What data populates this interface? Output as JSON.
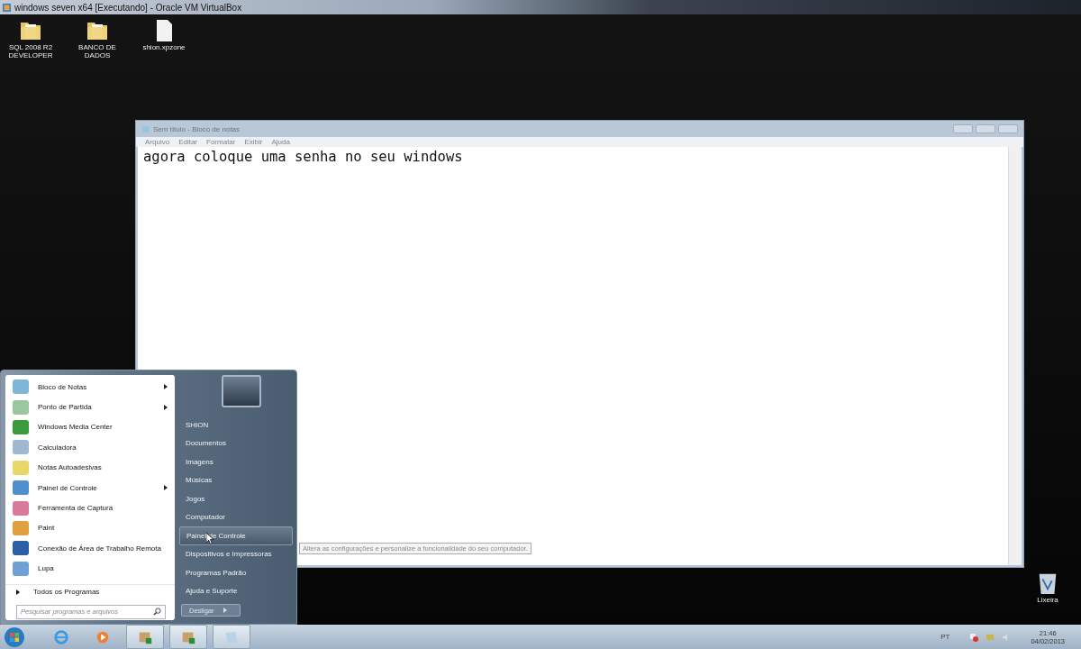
{
  "vm_window": {
    "title": "windows seven x64 [Executando] - Oracle VM VirtualBox"
  },
  "desktop_icons": [
    {
      "label": "SQL 2008 R2 DEVELOPER",
      "kind": "folder"
    },
    {
      "label": "BANCO DE DADOS",
      "kind": "folder"
    },
    {
      "label": "shion.xpzone",
      "kind": "file"
    }
  ],
  "recycle_bin": {
    "label": "Lixeira"
  },
  "notepad": {
    "title": "Sem título - Bloco de notas",
    "menu": [
      "Arquivo",
      "Editar",
      "Formatar",
      "Exibir",
      "Ajuda"
    ],
    "text": "agora coloque uma senha no seu windows"
  },
  "start_menu": {
    "programs": [
      {
        "label": "Bloco de Notas",
        "submenu": true,
        "kind": "notepad"
      },
      {
        "label": "Ponto de Partida",
        "submenu": true,
        "kind": "start"
      },
      {
        "label": "Windows Media Center",
        "submenu": false,
        "kind": "media"
      },
      {
        "label": "Calculadora",
        "submenu": false,
        "kind": "calc"
      },
      {
        "label": "Notas Autoadesivas",
        "submenu": false,
        "kind": "sticky"
      },
      {
        "label": "Painel de Controle",
        "submenu": true,
        "kind": "panel"
      },
      {
        "label": "Ferramenta de Captura",
        "submenu": false,
        "kind": "snip"
      },
      {
        "label": "Paint",
        "submenu": false,
        "kind": "paint"
      },
      {
        "label": "Conexão de Área de Trabalho Remota",
        "submenu": false,
        "kind": "remote"
      },
      {
        "label": "Lupa",
        "submenu": false,
        "kind": "magnifier"
      }
    ],
    "all_programs": "Todos os Programas",
    "search": {
      "placeholder": "Pesquisar programas e arquivos"
    },
    "places": [
      {
        "label": "SHION",
        "selected": false
      },
      {
        "label": "Documentos",
        "selected": false
      },
      {
        "label": "Imagens",
        "selected": false
      },
      {
        "label": "Músicas",
        "selected": false
      },
      {
        "label": "Jogos",
        "selected": false
      },
      {
        "label": "Computador",
        "selected": false
      },
      {
        "label": "Painel de Controle",
        "selected": true
      },
      {
        "label": "Dispositivos e Impressoras",
        "selected": false
      },
      {
        "label": "Programas Padrão",
        "selected": false
      },
      {
        "label": "Ajuda e Suporte",
        "selected": false
      }
    ],
    "shutdown": "Desligar"
  },
  "tooltip": "Altera as configurações e personalize a funcionalidade do seu computador.",
  "taskbar": {
    "buttons": [
      {
        "kind": "browser"
      },
      {
        "kind": "media"
      },
      {
        "kind": "app"
      },
      {
        "kind": "app"
      },
      {
        "kind": "notepad"
      }
    ]
  },
  "tray": {
    "language": "PT",
    "time": "21:46",
    "date": "04/02/2013"
  }
}
